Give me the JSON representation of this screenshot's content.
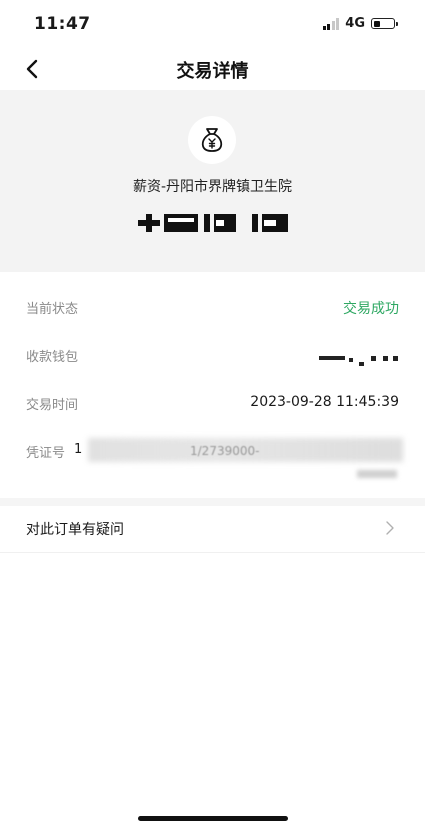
{
  "status_bar": {
    "time": "11:47",
    "network": "4G",
    "battery_level_percent": 35,
    "icons": [
      "signal-icon",
      "battery-icon"
    ]
  },
  "nav": {
    "title": "交易详情",
    "back_icon": "chevron-left-icon"
  },
  "transaction": {
    "merchant_icon": "money-bag-icon",
    "merchant_name": "薪资-丹阳市界牌镇卫生院"
  },
  "details": {
    "status_label": "当前状态",
    "status_value": "交易成功",
    "status_color": "#2fa863",
    "wallet_label": "收款钱包",
    "time_label": "交易时间",
    "time_value": "2023-09-28 11:45:39",
    "voucher_label": "凭证号",
    "voucher_value_visible": "1",
    "voucher_partial_text": "1/2739000-"
  },
  "actions": {
    "question_label": "对此订单有疑问",
    "question_icon": "chevron-right-icon"
  },
  "colors": {
    "accent_green": "#2fa863",
    "header_background": "#f3f3f3"
  }
}
